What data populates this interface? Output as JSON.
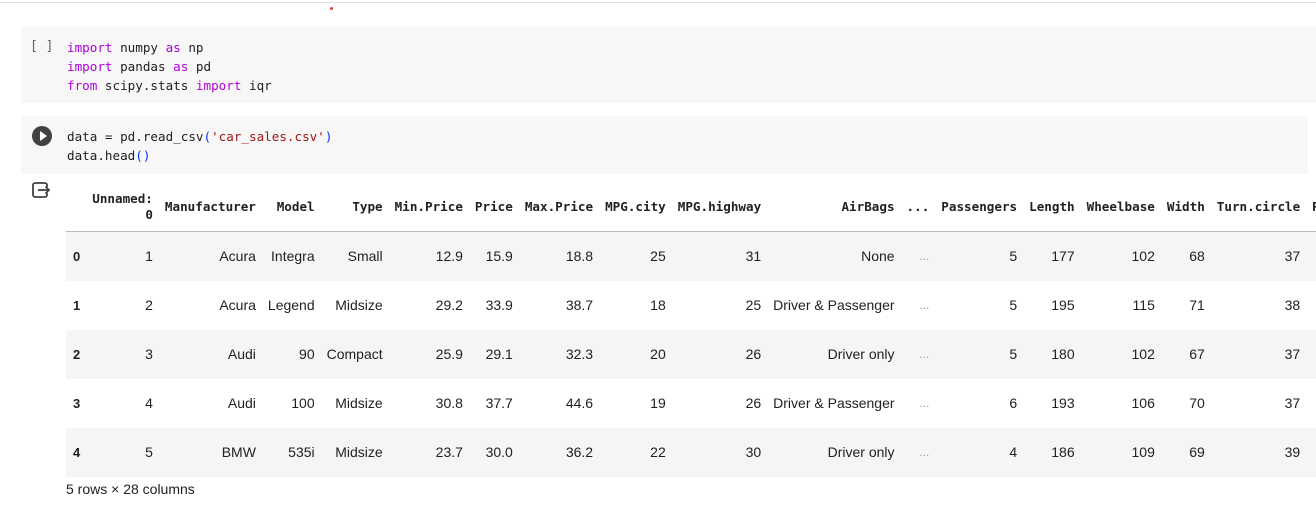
{
  "cells": [
    {
      "prompt": "[ ]",
      "lines": [
        [
          {
            "t": "import",
            "k": "kw"
          },
          {
            "t": " numpy ",
            "k": ""
          },
          {
            "t": "as",
            "k": "kw"
          },
          {
            "t": " np",
            "k": ""
          }
        ],
        [
          {
            "t": "import",
            "k": "kw"
          },
          {
            "t": " pandas ",
            "k": ""
          },
          {
            "t": "as",
            "k": "kw"
          },
          {
            "t": " pd",
            "k": ""
          }
        ],
        [
          {
            "t": "from",
            "k": "kw"
          },
          {
            "t": " scipy.stats ",
            "k": ""
          },
          {
            "t": "import",
            "k": "kw"
          },
          {
            "t": " iqr",
            "k": ""
          }
        ]
      ]
    },
    {
      "prompt": "run",
      "lines": [
        [
          {
            "t": "data = pd.read_csv",
            "k": ""
          },
          {
            "t": "(",
            "k": "paren"
          },
          {
            "t": "'car_sales.csv'",
            "k": "str"
          },
          {
            "t": ")",
            "k": "paren"
          }
        ],
        [
          {
            "t": "data.head",
            "k": ""
          },
          {
            "t": "()",
            "k": "paren"
          }
        ]
      ]
    }
  ],
  "table": {
    "columns": [
      "Unnamed:\n0",
      "Manufacturer",
      "Model",
      "Type",
      "Min.Price",
      "Price",
      "Max.Price",
      "MPG.city",
      "MPG.highway",
      "AirBags",
      "...",
      "Passengers",
      "Length",
      "Wheelbase",
      "Width",
      "Turn.circle",
      "R"
    ],
    "rows": [
      {
        "index": "0",
        "values": [
          "1",
          "Acura",
          "Integra",
          "Small",
          "12.9",
          "15.9",
          "18.8",
          "25",
          "31",
          "None",
          "...",
          "5",
          "177",
          "102",
          "68",
          "37",
          ""
        ]
      },
      {
        "index": "1",
        "values": [
          "2",
          "Acura",
          "Legend",
          "Midsize",
          "29.2",
          "33.9",
          "38.7",
          "18",
          "25",
          "Driver & Passenger",
          "...",
          "5",
          "195",
          "115",
          "71",
          "38",
          ""
        ]
      },
      {
        "index": "2",
        "values": [
          "3",
          "Audi",
          "90",
          "Compact",
          "25.9",
          "29.1",
          "32.3",
          "20",
          "26",
          "Driver only",
          "...",
          "5",
          "180",
          "102",
          "67",
          "37",
          ""
        ]
      },
      {
        "index": "3",
        "values": [
          "4",
          "Audi",
          "100",
          "Midsize",
          "30.8",
          "37.7",
          "44.6",
          "19",
          "26",
          "Driver & Passenger",
          "...",
          "6",
          "193",
          "106",
          "70",
          "37",
          ""
        ]
      },
      {
        "index": "4",
        "values": [
          "5",
          "BMW",
          "535i",
          "Midsize",
          "23.7",
          "30.0",
          "36.2",
          "22",
          "30",
          "Driver only",
          "...",
          "4",
          "186",
          "109",
          "69",
          "39",
          ""
        ]
      }
    ]
  },
  "summary": "5 rows × 28 columns",
  "icons": {
    "run": "play-circle-icon",
    "output": "output-exit-icon"
  }
}
